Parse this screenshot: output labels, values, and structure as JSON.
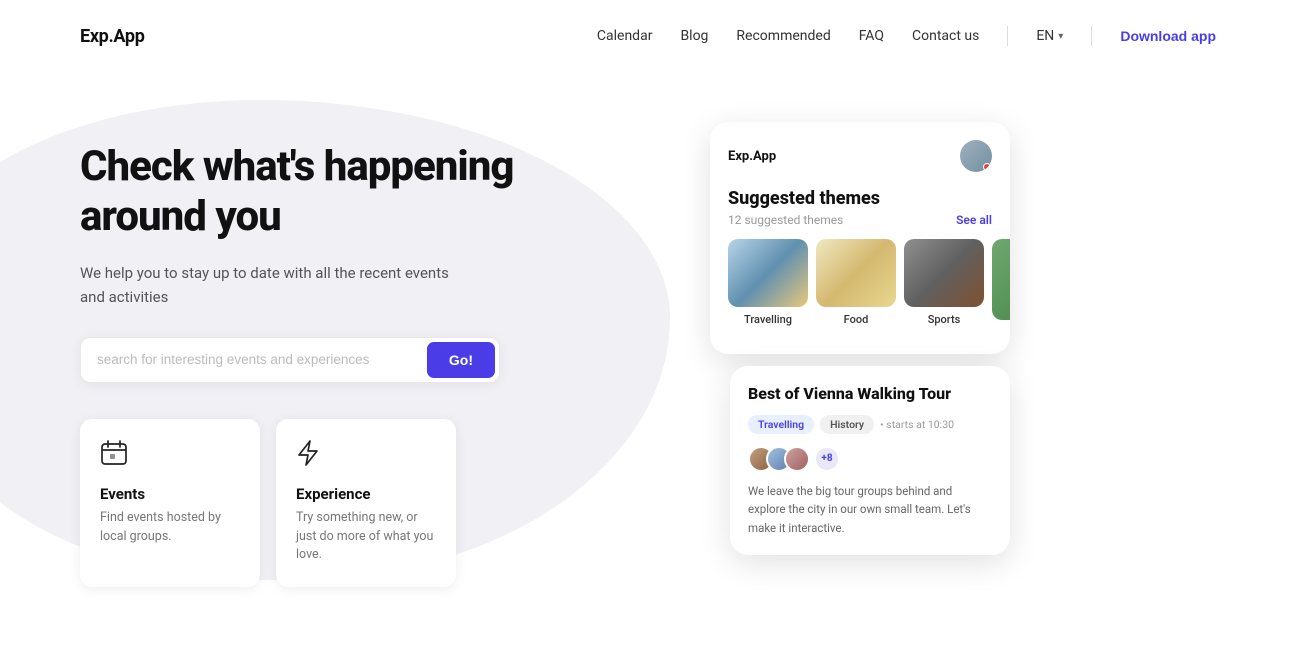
{
  "meta": {
    "title": "Exp.App"
  },
  "header": {
    "logo": "Exp.App",
    "nav": [
      {
        "label": "Calendar",
        "id": "calendar"
      },
      {
        "label": "Blog",
        "id": "blog"
      },
      {
        "label": "Recommended",
        "id": "recommended"
      },
      {
        "label": "FAQ",
        "id": "faq"
      },
      {
        "label": "Contact us",
        "id": "contact"
      }
    ],
    "lang": "EN",
    "download_label": "Download app"
  },
  "hero": {
    "title": "Check what's happening around you",
    "subtitle": "We help you to stay up to date with all the recent events and activities",
    "search_placeholder": "search for interesting events and experiences",
    "search_button": "Go!"
  },
  "features": [
    {
      "id": "events",
      "title": "Events",
      "desc": "Find events hosted by local groups."
    },
    {
      "id": "experience",
      "title": "Experience",
      "desc": "Try something new, or just do more of what you love."
    }
  ],
  "app_mockup": {
    "logo": "Exp.App",
    "suggested_themes": {
      "title": "Suggested themes",
      "count": "12 suggested themes",
      "see_all": "See all",
      "themes": [
        {
          "label": "Travelling"
        },
        {
          "label": "Food"
        },
        {
          "label": "Sports"
        }
      ]
    },
    "tour_card": {
      "title": "Best of Vienna Walking Tour",
      "tag1": "Travelling",
      "tag2": "History",
      "time": "• starts at 10:30",
      "plus": "+8",
      "desc": "We leave the big tour groups behind and explore the city in our own small team. Let's make it interactive."
    }
  }
}
